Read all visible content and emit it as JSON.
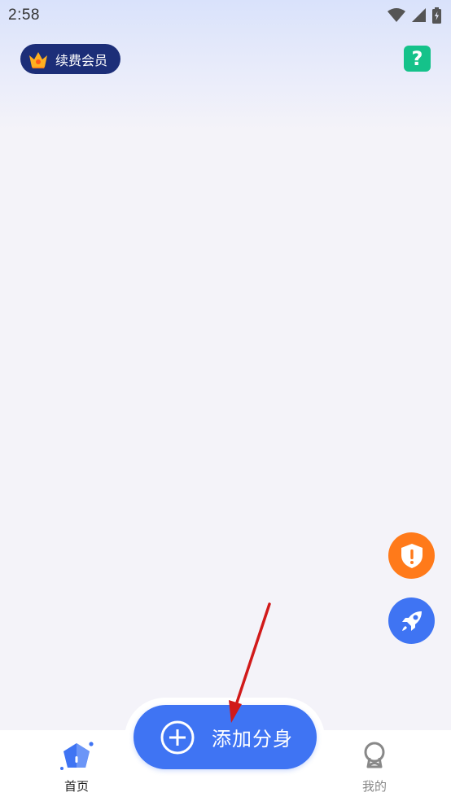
{
  "status_bar": {
    "time": "2:58",
    "icons": [
      "wifi-icon",
      "cell-signal-icon",
      "battery-charging-icon"
    ]
  },
  "header": {
    "vip_label": "续费会员",
    "vip_icon": "crown-icon",
    "help_label": "?",
    "help_icon": "help-icon"
  },
  "floating_buttons": [
    {
      "name": "shield-alert-button",
      "icon": "shield-alert-icon",
      "color": "#ff7a1a"
    },
    {
      "name": "rocket-boost-button",
      "icon": "rocket-icon",
      "color": "#3f74f3"
    }
  ],
  "add_button": {
    "label": "添加分身",
    "icon": "plus-circle-icon"
  },
  "bottom_nav": {
    "items": [
      {
        "label": "首页",
        "icon": "home-icon",
        "active": true
      },
      {
        "label": "我的",
        "icon": "profile-icon",
        "active": false
      }
    ]
  },
  "annotation": {
    "type": "red-arrow",
    "points_to": "add-button",
    "color": "#d11a1a"
  },
  "colors": {
    "primary": "#3f74f3",
    "vip_badge": "#1c2e78",
    "help": "#15c28a",
    "warning": "#ff7a1a",
    "background": "#f4f3f9"
  }
}
